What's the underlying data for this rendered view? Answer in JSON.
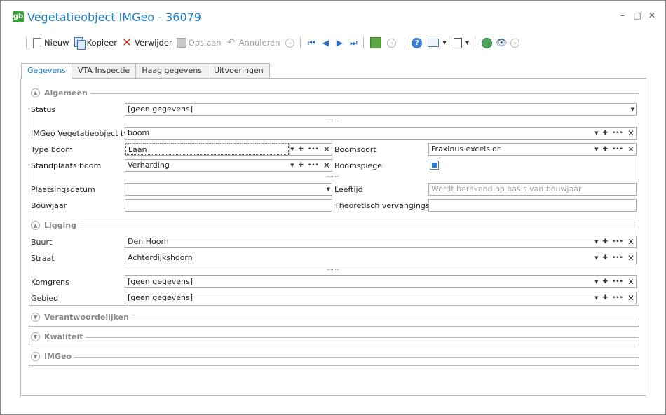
{
  "window": {
    "title": "Vegetatieobject IMGeo - 36079",
    "logo_text": "gb",
    "controls": {
      "minimize": "–",
      "maximize": "□",
      "close": "✕"
    }
  },
  "toolbar": {
    "new_label": "Nieuw",
    "copy_label": "Kopieer",
    "delete_label": "Verwijder",
    "save_label": "Opslaan",
    "cancel_label": "Annuleren"
  },
  "tabs": [
    {
      "label": "Gegevens",
      "active": true
    },
    {
      "label": "VTA Inspectie",
      "active": false
    },
    {
      "label": "Haag gegevens",
      "active": false
    },
    {
      "label": "Uitvoeringen",
      "active": false
    }
  ],
  "groups": {
    "algemeen": {
      "title": "Algemeen",
      "status_label": "Status",
      "status_value": "[geen gegevens]",
      "type_label": "IMGeo Vegetatieobject type",
      "type_value": "boom",
      "typeboom_label": "Type boom",
      "typeboom_value": "Laan",
      "boomsoort_label": "Boomsoort",
      "boomsoort_value": "Fraxinus excelsior",
      "standplaats_label": "Standplaats boom",
      "standplaats_value": "Verharding",
      "boomspiegel_label": "Boomspiegel",
      "boomspiegel_checked": true,
      "plaatsingsdatum_label": "Plaatsingsdatum",
      "plaatsingsdatum_value": "",
      "leeftijd_label": "Leeftijd",
      "leeftijd_placeholder": "Wordt berekend op basis van bouwjaar",
      "bouwjaar_label": "Bouwjaar",
      "bouwjaar_value": "",
      "vervanging_label": "Theoretisch vervangingsjaar",
      "vervanging_value": ""
    },
    "ligging": {
      "title": "Ligging",
      "buurt_label": "Buurt",
      "buurt_value": "Den Hoorn",
      "straat_label": "Straat",
      "straat_value": "Achterdijkshoorn",
      "komgrens_label": "Komgrens",
      "komgrens_value": "[geen gegevens]",
      "gebied_label": "Gebied",
      "gebied_value": "[geen gegevens]"
    },
    "verantwoordelijken": {
      "title": "Verantwoordelijken"
    },
    "kwaliteit": {
      "title": "Kwaliteit"
    },
    "imgeo": {
      "title": "IMGeo"
    }
  },
  "icons": {
    "group_expanded": "chevron-up-circle-icon",
    "group_collapsed": "chevron-down-circle-icon"
  }
}
